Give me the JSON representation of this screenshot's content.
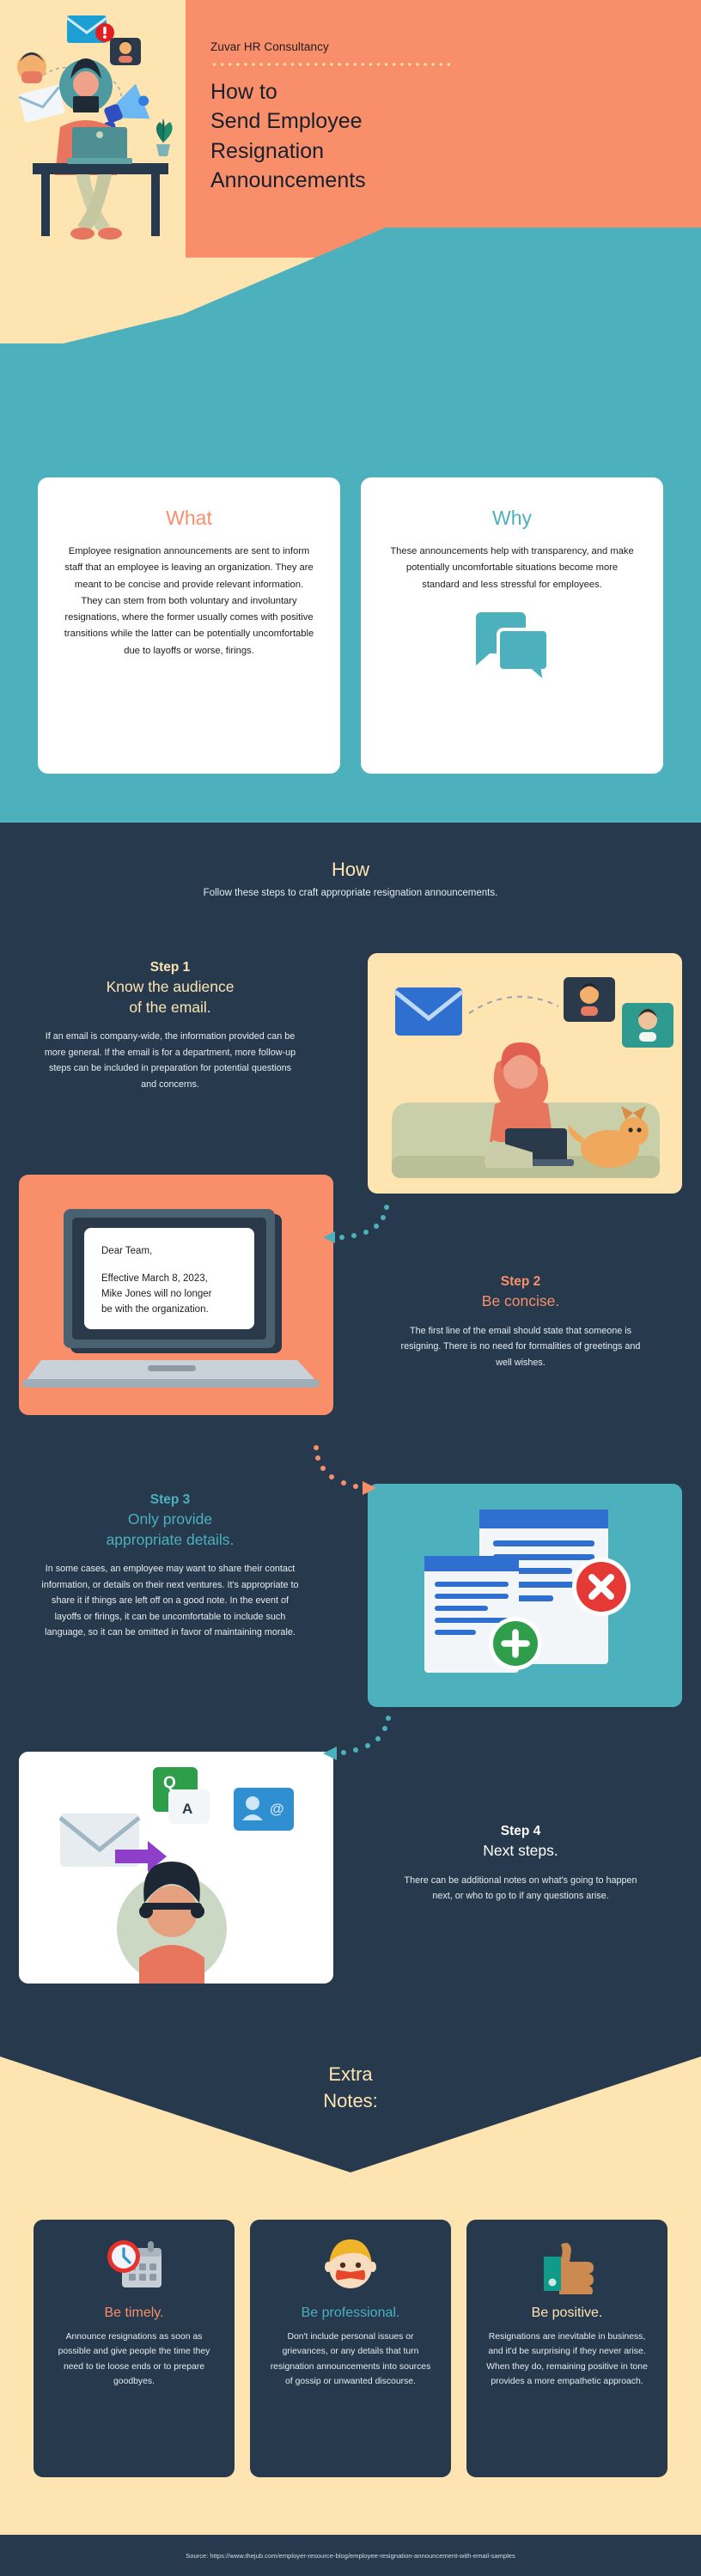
{
  "hero": {
    "brand": "Zuvar HR Consultancy",
    "title_lines": [
      "How to",
      "Send Employee",
      "Resignation",
      "Announcements"
    ],
    "accent_orange": "#f98e6b",
    "accent_cream": "#fde4b0",
    "accent_teal": "#4cb0bd",
    "accent_dark": "#26394d"
  },
  "overview": {
    "cards": [
      {
        "title": "What",
        "body": "Employee resignation announcements are sent to inform staff that an employee is leaving an organization. They are meant to be concise and provide relevant information. They can stem from both voluntary and involuntary resignations, where the former usually comes with positive transitions while the latter can be potentially uncomfortable due to layoffs or worse, firings.",
        "color": "#f98e6b",
        "icon": ""
      },
      {
        "title": "Why",
        "body": "These announcements help with transparency, and make potentially uncomfortable situations become more standard and less stressful for employees.",
        "color": "#4cb0bd",
        "icon": "chat-bubbles-icon"
      }
    ]
  },
  "how": {
    "heading": "How",
    "subheading": "Follow these steps to craft appropriate resignation announcements.",
    "steps": [
      {
        "number": "Step 1",
        "title_lines": [
          "Know the audience",
          "of the email."
        ],
        "body": "If an email is company-wide, the information provided can be more general. If the email is for a department, more follow-up steps can be included in preparation for potential questions and concerns.",
        "color": "#fde4b0",
        "illustration": "woman-on-couch-with-laptop-and-dog"
      },
      {
        "number": "Step 2",
        "title_lines": [
          "Be concise."
        ],
        "body": "The first line of the email should state that someone is resigning. There is no need for formalities of greetings and well wishes.",
        "color": "#f98e6b",
        "illustration": "laptop-showing-email"
      },
      {
        "number": "Step 3",
        "title_lines": [
          "Only provide",
          "appropriate details."
        ],
        "body": "In some cases, an employee may want to share their contact information, or details on their next ventures. It's appropriate to share it if things are left off on a good note. In the event of layoffs or firings, it can be uncomfortable to include such language, so it can be omitted in favor of maintaining morale.",
        "color": "#4cb0bd",
        "illustration": "documents-with-check-and-cross"
      },
      {
        "number": "Step 4",
        "title_lines": [
          "Next steps."
        ],
        "body": "There can be additional notes on what's going to happen next, or who to go to if any questions arise.",
        "color": "#ffffff",
        "illustration": "person-with-mail-and-contact-icons"
      }
    ]
  },
  "laptop_email": {
    "greeting": "Dear Team,",
    "line1": "Effective March 8, 2023,",
    "line2": "Mike Jones will no longer",
    "line3": "be with the organization."
  },
  "extra": {
    "heading_lines": [
      "Extra",
      "Notes:"
    ],
    "notes": [
      {
        "icon": "clock-calendar-icon",
        "title": "Be timely.",
        "color": "#f98e6b",
        "body": "Announce resignations as soon as possible and give people the time they need to tie loose ends or to prepare goodbyes."
      },
      {
        "icon": "silenced-face-icon",
        "title": "Be professional.",
        "color": "#4cb0bd",
        "body": "Don't include personal issues or grievances, or any details that turn resignation announcements into sources of gossip or unwanted discourse."
      },
      {
        "icon": "thumbs-up-icon",
        "title": "Be positive.",
        "color": "#fde4b0",
        "body": "Resignations are inevitable in business, and it'd be surprising if they never arise. When they do, remaining positive in tone provides a more empathetic approach."
      }
    ]
  },
  "footer": {
    "source": "Source: https://www.thejub.com/employer-resource-blog/employee-resignation-announcement-with-email-samples"
  }
}
